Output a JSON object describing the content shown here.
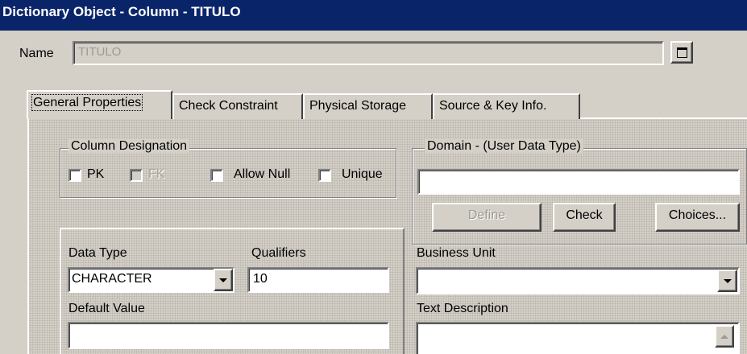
{
  "window": {
    "title": "Dictionary Object - Column - TITULO"
  },
  "name_row": {
    "label": "Name",
    "value": "TITULO"
  },
  "tabs": [
    {
      "label": "General Properties",
      "active": true
    },
    {
      "label": "Check Constraint",
      "active": false
    },
    {
      "label": "Physical Storage",
      "active": false
    },
    {
      "label": "Source & Key Info.",
      "active": false
    }
  ],
  "column_designation": {
    "label": "Column Designation",
    "pk": "PK",
    "fk": "FK",
    "allow_null": "Allow Null",
    "unique": "Unique"
  },
  "domain": {
    "label": "Domain - (User Data Type)",
    "value": "",
    "define_label": "Define",
    "check_label": "Check",
    "choices_label": "Choices..."
  },
  "data_type": {
    "label": "Data Type",
    "value": "CHARACTER"
  },
  "qualifiers": {
    "label": "Qualifiers",
    "value": "10"
  },
  "default_value": {
    "label": "Default Value",
    "value": ""
  },
  "business_unit": {
    "label": "Business Unit",
    "value": ""
  },
  "text_description": {
    "label": "Text Description",
    "value": ""
  },
  "icons": {
    "name_button": "window-icon",
    "dropdown": "chevron-down-icon",
    "scroll_up": "scroll-up-arrow-icon"
  },
  "colors": {
    "titlebar": "#0a246a",
    "face": "#d4d0c8"
  }
}
